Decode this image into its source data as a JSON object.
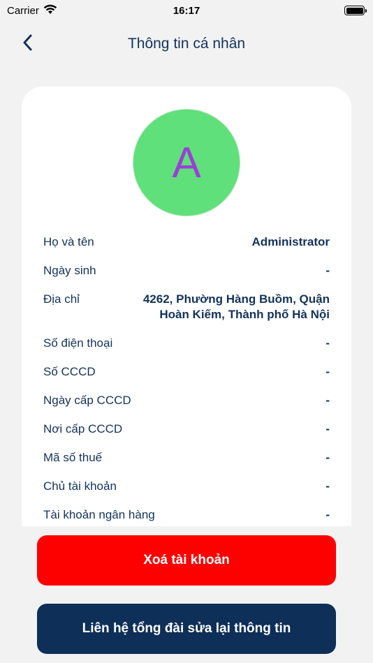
{
  "status_bar": {
    "carrier": "Carrier",
    "time": "16:17",
    "icons": [
      "wifi-icon",
      "battery-icon"
    ]
  },
  "header": {
    "title": "Thông tin cá nhân",
    "back_icon": "chevron-left-icon"
  },
  "avatar": {
    "initial": "A",
    "bg_color": "#5fe07a",
    "letter_color": "#9b3fd9"
  },
  "info": [
    {
      "label": "Họ và tên",
      "value": "Administrator"
    },
    {
      "label": "Ngày sinh",
      "value": "-"
    },
    {
      "label": "Địa chỉ",
      "value": "4262, Phường Hàng Buồm, Quận Hoàn Kiếm, Thành phố Hà Nội"
    },
    {
      "label": "Số điện thoại",
      "value": "-"
    },
    {
      "label": "Số CCCD",
      "value": "-"
    },
    {
      "label": "Ngày cấp CCCD",
      "value": "-"
    },
    {
      "label": "Nơi cấp CCCD",
      "value": "-"
    },
    {
      "label": "Mã số thuế",
      "value": "-"
    },
    {
      "label": "Chủ tài khoản",
      "value": "-"
    },
    {
      "label": "Tài khoản ngân hàng",
      "value": "-"
    }
  ],
  "buttons": {
    "delete_label": "Xoá tài khoản",
    "contact_label": "Liên hệ tổng đài sửa lại thông tin",
    "delete_color": "#fd0000",
    "contact_color": "#0d2f58"
  }
}
